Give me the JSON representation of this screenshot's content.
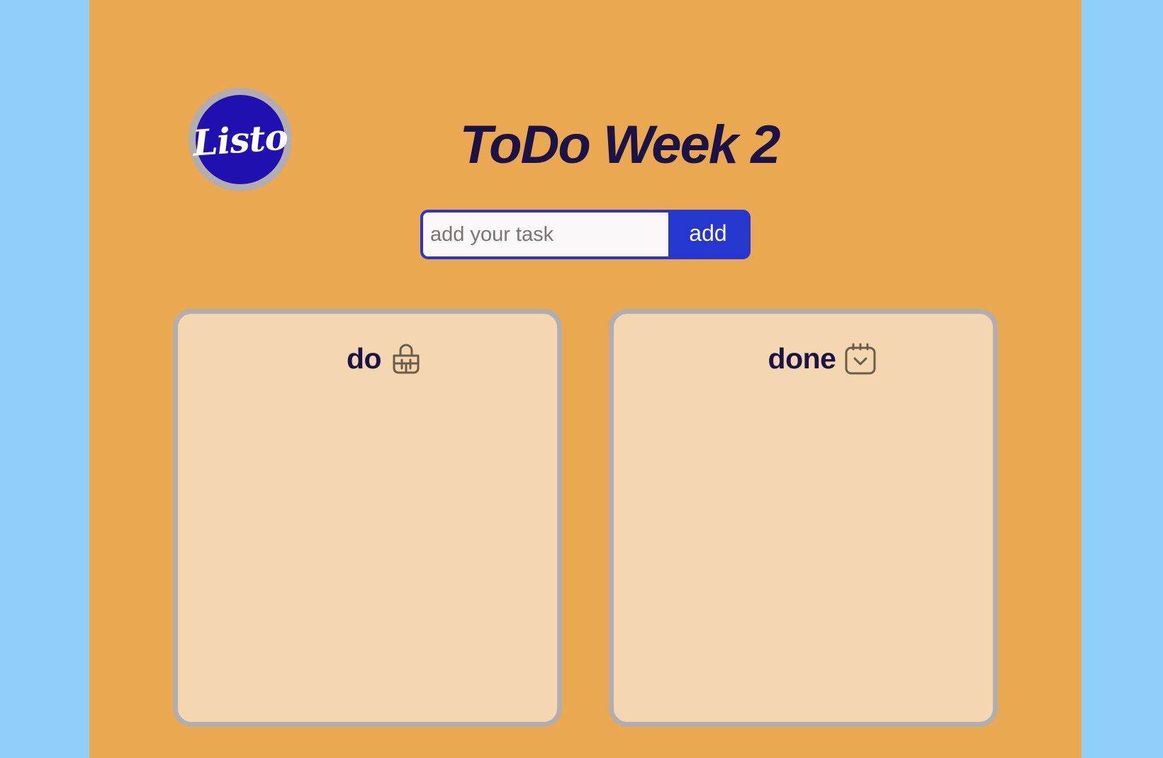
{
  "header": {
    "logo_text": "Listo",
    "title": "ToDo Week 2"
  },
  "form": {
    "input_value": "",
    "input_placeholder": "add your task",
    "add_label": "add"
  },
  "panels": [
    {
      "title": "do",
      "icon": "shopping-bag-icon",
      "items": []
    },
    {
      "title": "done",
      "icon": "calendar-check-icon",
      "items": []
    }
  ],
  "colors": {
    "page_background": "#eaa850",
    "outer_background": "#90cff8",
    "logo_circle": "#2010b0",
    "title_text": "#1b1347",
    "button": "#2637cf",
    "panel_background": "#f4d7b0",
    "panel_border": "#b2adaf"
  }
}
